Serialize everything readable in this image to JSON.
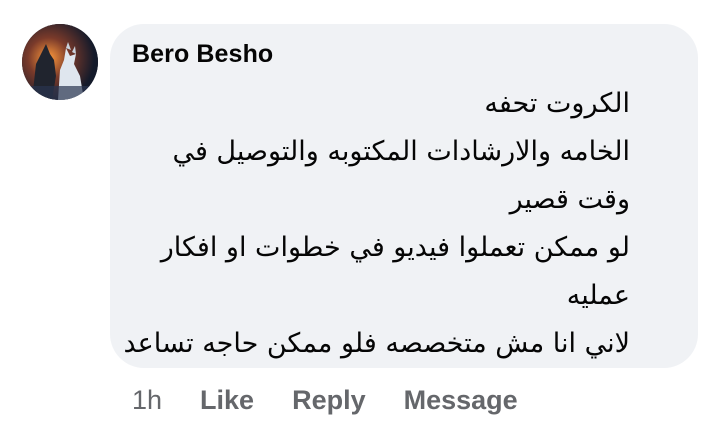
{
  "comment": {
    "author": "Bero Besho",
    "avatar_icon": "profile-photo-wolf",
    "lines": [
      "الكروت تحفه",
      "الخامه والارشادات المكتوبه والتوصيل في",
      "وقت قصير",
      "لو ممكن تعملوا فيديو في خطوات او افكار",
      "عمليه",
      "لاني انا مش متخصصه فلو ممكن حاجه تساعد"
    ],
    "timestamp": "1h",
    "actions": {
      "like": "Like",
      "reply": "Reply",
      "message": "Message"
    }
  },
  "colors": {
    "bubble_bg": "#f0f2f5",
    "text": "#050505",
    "secondary_text": "#65676b"
  }
}
